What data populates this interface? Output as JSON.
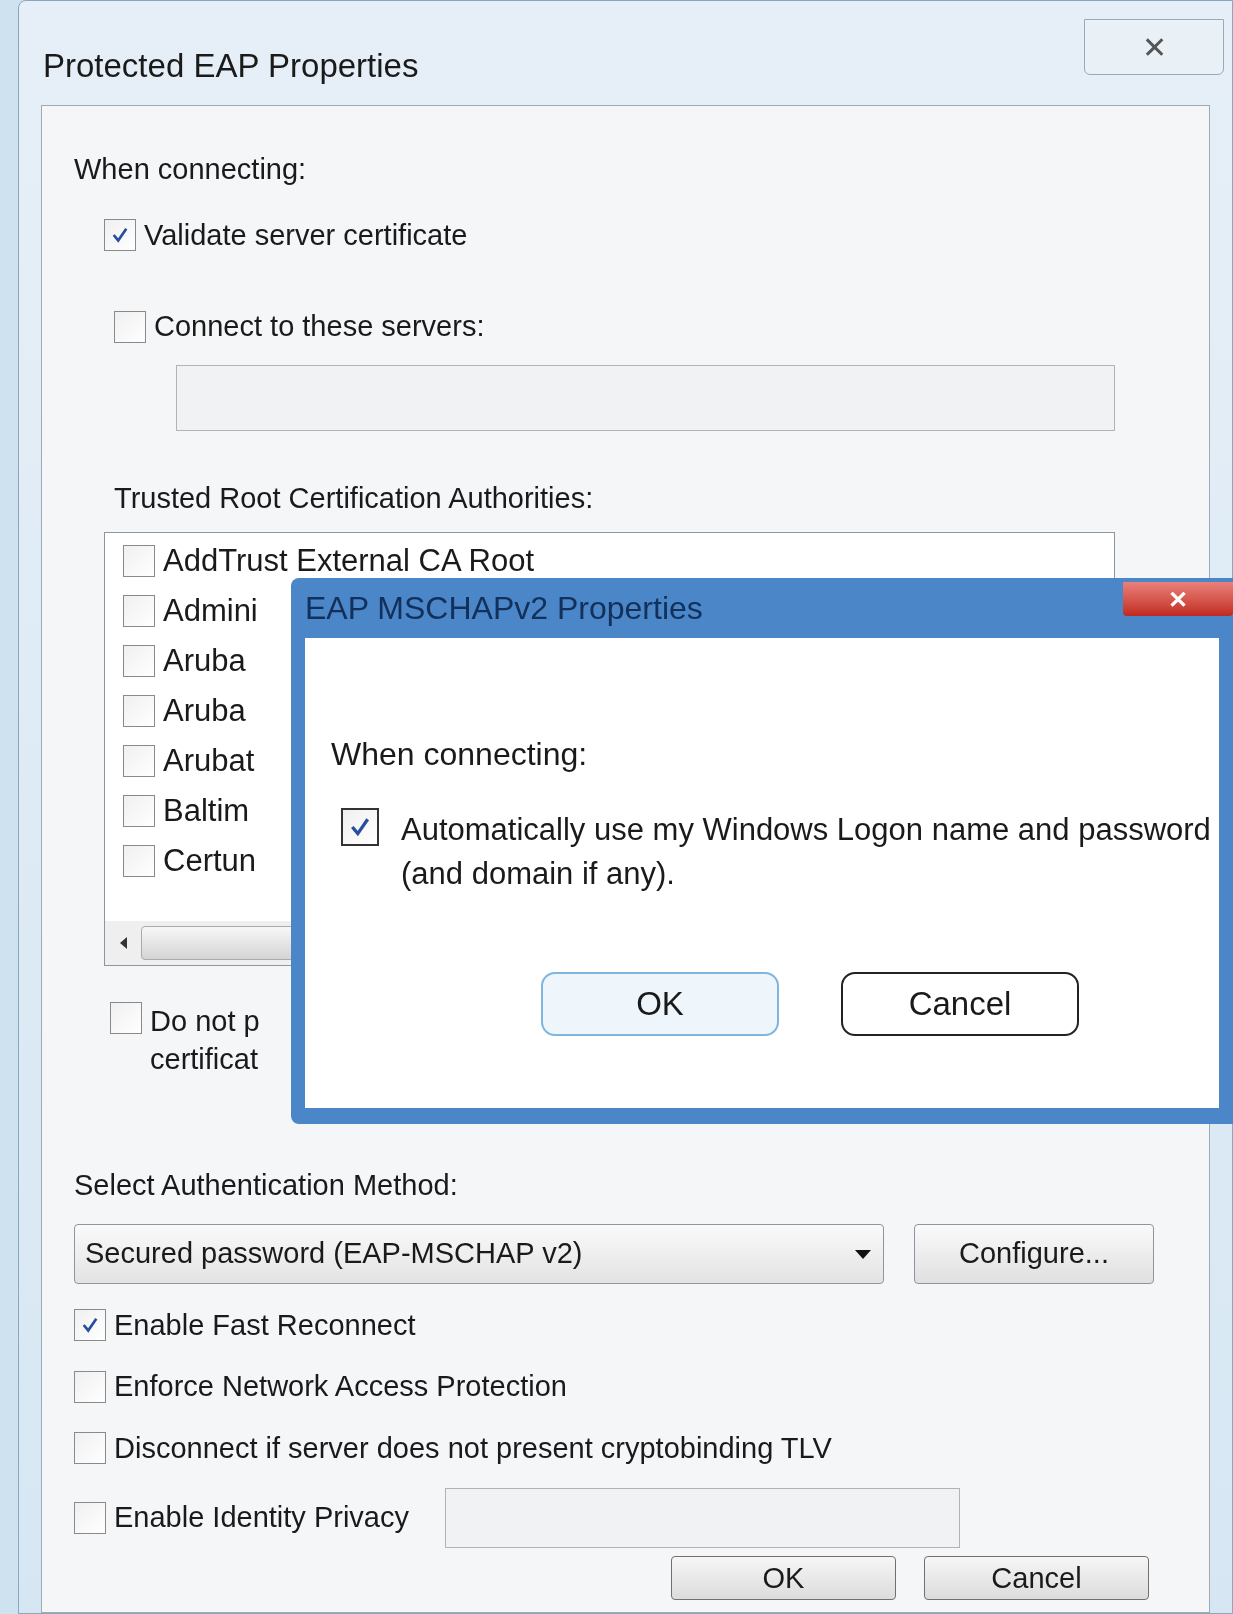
{
  "window": {
    "title": "Protected EAP Properties",
    "close": "✕"
  },
  "when_connecting_label": "When connecting:",
  "validate_server_certificate": {
    "label": "Validate server certificate",
    "checked": true
  },
  "connect_to_servers": {
    "label": "Connect to these servers:",
    "checked": false
  },
  "trusted_root_label": "Trusted Root Certification Authorities:",
  "authorities": [
    {
      "label": "AddTrust External CA Root",
      "checked": false
    },
    {
      "label": "Admini",
      "checked": false
    },
    {
      "label": "Aruba",
      "checked": false
    },
    {
      "label": "Aruba",
      "checked": false
    },
    {
      "label": "Arubat",
      "checked": false
    },
    {
      "label": "Baltim",
      "checked": false
    },
    {
      "label": "Certun",
      "checked": false
    }
  ],
  "do_not_prompt": {
    "lines": [
      "Do not p",
      "certificat"
    ],
    "checked": false
  },
  "auth_method_label": "Select Authentication Method:",
  "auth_method": {
    "value": "Secured password (EAP-MSCHAP v2)"
  },
  "configure_button": "Configure...",
  "options": [
    {
      "label": "Enable Fast Reconnect",
      "checked": true
    },
    {
      "label": "Enforce Network Access Protection",
      "checked": false
    },
    {
      "label": "Disconnect if server does not present cryptobinding TLV",
      "checked": false
    },
    {
      "label": "Enable Identity Privacy",
      "checked": false
    }
  ],
  "buttons": [
    "OK",
    "Cancel"
  ],
  "dialog": {
    "title": "EAP MSCHAPv2 Properties",
    "close": "✕",
    "when_connecting_label": "When connecting:",
    "auto_logon": {
      "label": "Automatically use my Windows Logon name and password (and domain if any).",
      "checked": true
    },
    "buttons": [
      {
        "label": "OK",
        "default": true
      },
      {
        "label": "Cancel",
        "default": false
      }
    ]
  }
}
